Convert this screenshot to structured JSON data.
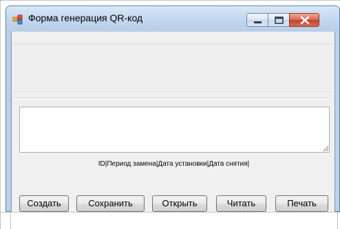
{
  "window": {
    "title": "Форма генерация  QR-код"
  },
  "main": {
    "textbox_value": "",
    "columns_label": "ID|Период замена|Дата установки|Дата снятия|"
  },
  "buttons": {
    "create": "Создать",
    "save": "Сохранить",
    "open": "Открыть",
    "read": "Читать",
    "print": "Печать"
  }
}
